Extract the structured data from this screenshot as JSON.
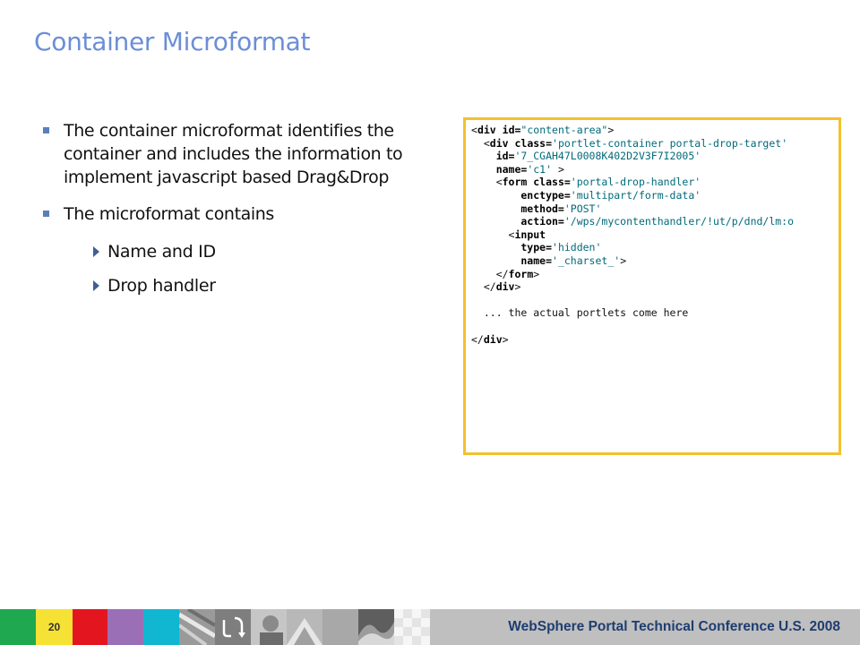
{
  "slide": {
    "title": "Container Microformat",
    "bullets": [
      {
        "text": "The container microformat identifies the container and includes the information to implement javascript based Drag&Drop"
      },
      {
        "text": "The microformat contains"
      }
    ],
    "sub_bullets": [
      {
        "text": "Name and ID"
      },
      {
        "text": "Drop handler"
      }
    ]
  },
  "code": {
    "l1_open": "<",
    "l1_tag": "div",
    "l1_attr": " id=",
    "l1_val": "\"content-area\"",
    "l1_close": ">",
    "l2_indent": "  <",
    "l2_tag": "div",
    "l2_attr": " class=",
    "l2_val": "'portlet-container portal-drop-target'",
    "l3_attr": "    id=",
    "l3_val": "'7_CGAH47L0008K402D2V3F7I2005'",
    "l4_attr": "    name=",
    "l4_val": "'c1'",
    "l4_close": " >",
    "l5_indent": "    <",
    "l5_tag": "form",
    "l5_attr": " class=",
    "l5_val": "'portal-drop-handler'",
    "l6_attr": "        enctype=",
    "l6_val": "'multipart/form-data'",
    "l7_attr": "        method=",
    "l7_val": "'POST'",
    "l8_attr": "        action=",
    "l8_val": "'/wps/mycontenthandler/!ut/p/dnd/lm:o",
    "l9_indent": "      <",
    "l9_tag": "input",
    "l10_attr": "        type=",
    "l10_val": "'hidden'",
    "l11_attr": "        name=",
    "l11_val": "'_charset_'",
    "l11_close": ">",
    "l12_indent": "    </",
    "l12_tag": "form",
    "l12_close": ">",
    "l13_indent": "  </",
    "l13_tag": "div",
    "l13_close": ">",
    "l15": "  ... the actual portlets come here",
    "l17_open": "</",
    "l17_tag": "div",
    "l17_close": ">"
  },
  "footer": {
    "page_number": "20",
    "conference": "WebSphere Portal Technical Conference U.S. 2008",
    "colors": [
      "#1fa84f",
      "#f5e234",
      "#e3161f",
      "#9b6fb5",
      "#11b7d1"
    ]
  }
}
